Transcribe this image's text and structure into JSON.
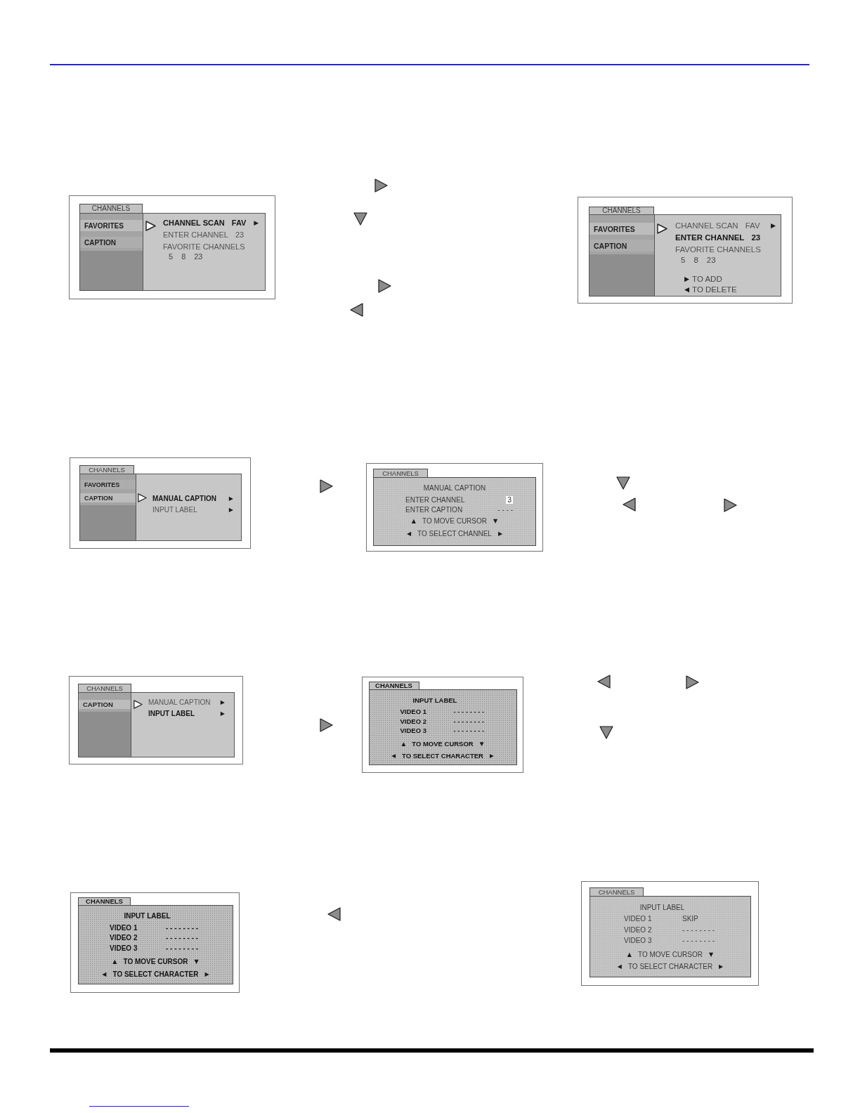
{
  "screens": [
    {
      "kind": "menu",
      "tab": "CHANNELS",
      "sidebar": [
        {
          "label": "FAVORITES",
          "selected": true
        },
        {
          "label": "CAPTION",
          "selected": false
        }
      ],
      "items": [
        {
          "label": "CHANNEL SCAN",
          "value": "FAV",
          "arrow": "▶",
          "selected": true
        },
        {
          "label": "ENTER CHANNEL",
          "value": "23",
          "selected": false
        },
        {
          "label": "FAVORITE CHANNELS",
          "selected": false
        }
      ],
      "channel_list": [
        "5",
        "8",
        "23"
      ]
    },
    {
      "kind": "menu",
      "tab": "CHANNELS",
      "sidebar": [
        {
          "label": "FAVORITES",
          "selected": true
        },
        {
          "label": "CAPTION",
          "selected": false
        }
      ],
      "items": [
        {
          "label": "CHANNEL SCAN",
          "value": "FAV",
          "arrow": "▶",
          "selected": false
        },
        {
          "label": "ENTER CHANNEL",
          "value": "23",
          "selected": true
        },
        {
          "label": "FAVORITE CHANNELS",
          "selected": false
        }
      ],
      "channel_list": [
        "5",
        "8",
        "23"
      ],
      "hints": [
        {
          "left": "▶",
          "text": "TO ADD"
        },
        {
          "left": "◀",
          "text": "TO DELETE"
        }
      ]
    },
    {
      "kind": "menu",
      "tab": "CHANNELS",
      "sidebar": [
        {
          "label": "FAVORITES",
          "selected": false
        },
        {
          "label": "CAPTION",
          "selected": true
        }
      ],
      "items": [
        {
          "label": "MANUAL CAPTION",
          "arrow": "▶",
          "selected": true
        },
        {
          "label": "INPUT LABEL",
          "arrow": "▶",
          "selected": false
        }
      ]
    },
    {
      "kind": "form",
      "tab": "CHANNELS",
      "title": "MANUAL CAPTION",
      "rows": [
        {
          "label": "ENTER CHANNEL",
          "value": "3",
          "cursor": true
        },
        {
          "label": "ENTER CAPTION",
          "value": "- - - -",
          "cursor": false
        }
      ],
      "hints": [
        {
          "left": "▲",
          "text": "TO MOVE CURSOR",
          "right": "▼"
        },
        {
          "left": "◀",
          "text": "TO SELECT CHANNEL",
          "right": "▶"
        }
      ]
    },
    {
      "kind": "menu",
      "tab": "CHANNELS",
      "sidebar": [
        {
          "label": "CAPTION",
          "selected": true
        }
      ],
      "items": [
        {
          "label": "MANUAL CAPTION",
          "arrow": "▶",
          "selected": false
        },
        {
          "label": "INPUT LABEL",
          "arrow": "▶",
          "selected": true
        }
      ]
    },
    {
      "kind": "form",
      "tab": "CHANNELS",
      "title": "INPUT LABEL",
      "rows": [
        {
          "label": "VIDEO 1",
          "value": "- - - - - - - -",
          "cursor": false
        },
        {
          "label": "VIDEO 2",
          "value": "- - - - - - - -",
          "cursor": false
        },
        {
          "label": "VIDEO 3",
          "value": "- - - - - - - -",
          "cursor": false
        }
      ],
      "hints": [
        {
          "left": "▲",
          "text": "TO MOVE CURSOR",
          "right": "▼"
        },
        {
          "left": "◀",
          "text": "TO SELECT CHARACTER",
          "right": "▶"
        }
      ]
    },
    {
      "kind": "form",
      "tab": "CHANNELS",
      "title": "INPUT LABEL",
      "rows": [
        {
          "label": "VIDEO 1",
          "value": "- - - - - - - -",
          "cursor": false
        },
        {
          "label": "VIDEO 2",
          "value": "- - - - - - - -",
          "cursor": false
        },
        {
          "label": "VIDEO 3",
          "value": "- - - - - - - -",
          "cursor": false
        }
      ],
      "hints": [
        {
          "left": "▲",
          "text": "TO MOVE CURSOR",
          "right": "▼"
        },
        {
          "left": "◀",
          "text": "TO SELECT CHARACTER",
          "right": "▶"
        }
      ]
    },
    {
      "kind": "form",
      "tab": "CHANNELS",
      "title": "INPUT LABEL",
      "rows": [
        {
          "label": "VIDEO 1",
          "value": "SKIP",
          "cursor": false
        },
        {
          "label": "VIDEO 2",
          "value": "- - - - - - - -",
          "cursor": false
        },
        {
          "label": "VIDEO 3",
          "value": "- - - - - - - -",
          "cursor": false
        }
      ],
      "hints": [
        {
          "left": "▲",
          "text": "TO MOVE CURSOR",
          "right": "▼"
        },
        {
          "left": "◀",
          "text": "TO SELECT CHARACTER",
          "right": "▶"
        }
      ]
    }
  ]
}
